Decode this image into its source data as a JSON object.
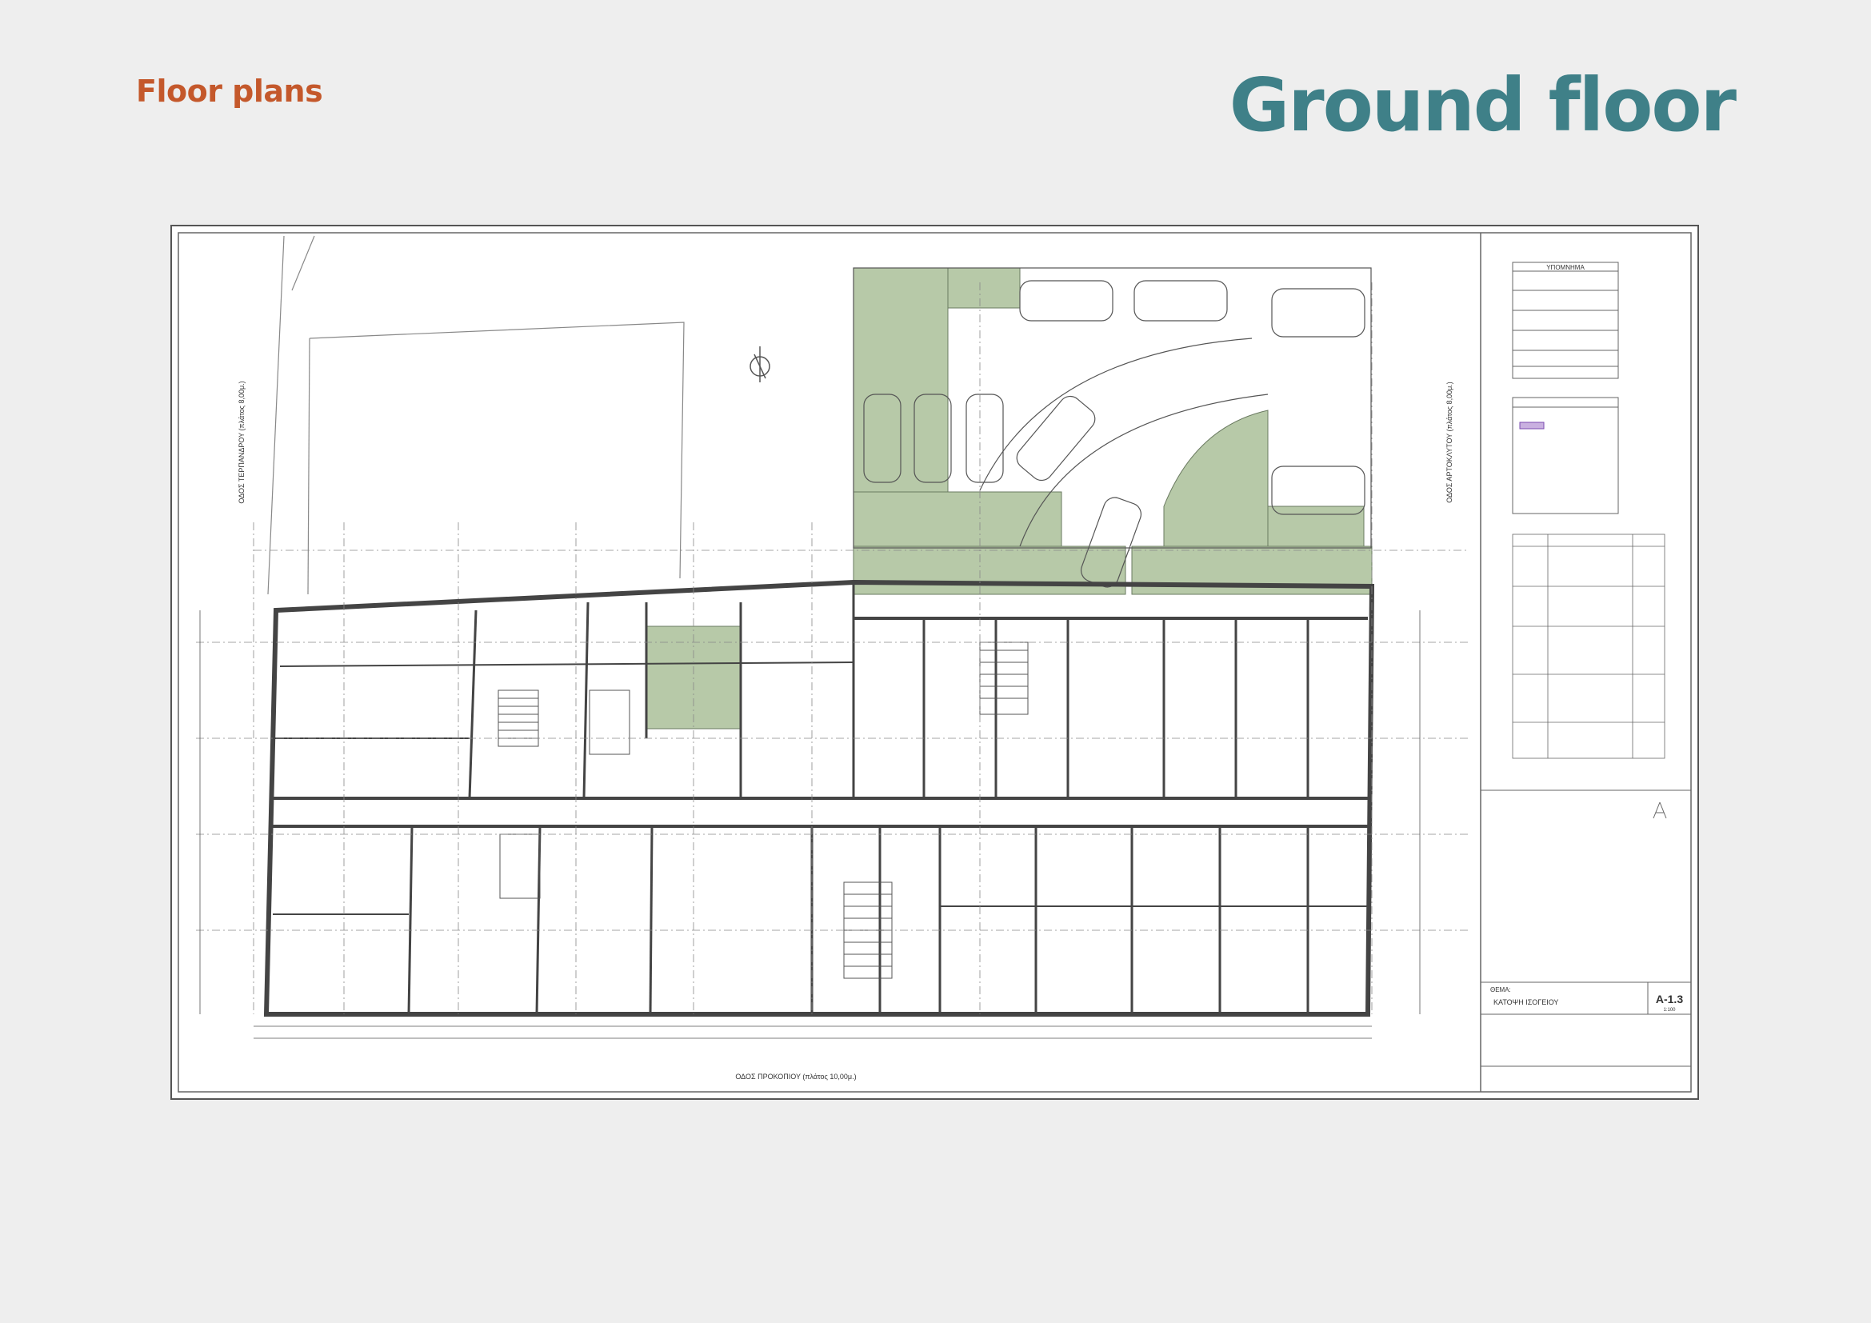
{
  "header": {
    "section_label": "Floor plans",
    "title": "Ground floor"
  },
  "colors": {
    "section_label": "#c4582b",
    "title": "#3f8088",
    "landscape_green": "#b7c9a8",
    "wall": "#444444"
  },
  "drawing": {
    "street_bottom": "ΟΔΟΣ ΠΡΟΚΟΠΙΟΥ (πλάτος 10,00μ.)",
    "street_left": "ΟΔΟΣ ΤΕΡΠΑΝΔΡΟΥ (πλάτος 8,00μ.)",
    "street_right": "ΟΔΟΣ ΑΡΤΟΚΛΥΤΟΥ (πλάτος 8,00μ.)",
    "title_block": {
      "theme_label": "ΘΕΜΑ:",
      "sheet_title": "ΚΑΤΟΨΗ ΙΣΟΓΕΙΟΥ",
      "sheet_number": "A-1.3",
      "scale": "1:100",
      "legend_title": "ΥΠΟΜΝΗΜΑ"
    }
  }
}
